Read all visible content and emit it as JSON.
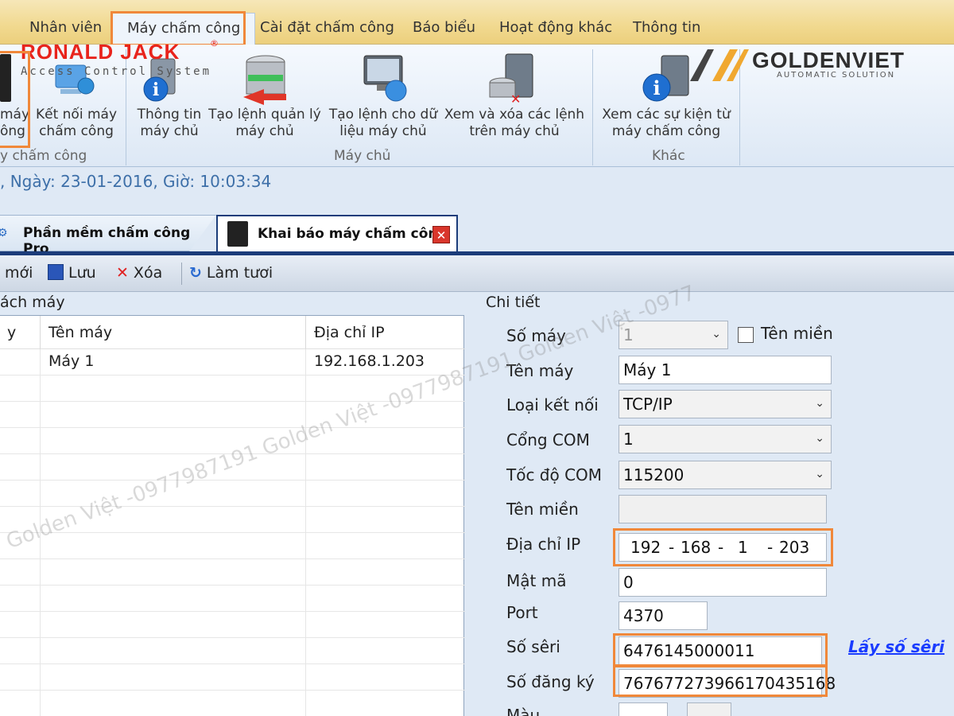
{
  "menu": {
    "items": [
      "Nhân viên",
      "Máy chấm công",
      "Cài đặt chấm công",
      "Báo biểu",
      "Hoạt động khác",
      "Thông tin"
    ],
    "active_index": 1
  },
  "ribbon": {
    "brand_left": {
      "name": "RONALD JACK",
      "reg": "®",
      "tagline": "Access Control System"
    },
    "brand_right": {
      "name": "GOLDENVIET",
      "tagline": "AUTOMATIC SOLUTION"
    },
    "group1": {
      "label": "y chấm công",
      "btn_partial_line1": "máy",
      "btn_partial_line2": "ông",
      "btn_connect_line1": "Kết nối máy",
      "btn_connect_line2": "chấm công"
    },
    "group2": {
      "label": "Máy chủ",
      "buttons": [
        {
          "line1": "Thông tin",
          "line2": "máy chủ"
        },
        {
          "line1": "Tạo lệnh quản lý",
          "line2": "máy chủ"
        },
        {
          "line1": "Tạo lệnh cho dữ",
          "line2": "liệu máy chủ"
        },
        {
          "line1": "Xem và xóa các lệnh",
          "line2": "trên máy chủ"
        }
      ]
    },
    "group3": {
      "label": "Khác",
      "buttons": [
        {
          "line1": "Xem các sự kiện từ",
          "line2": "máy chấm công"
        }
      ]
    }
  },
  "status": {
    "text": ", Ngày: 23-01-2016, Giờ: 10:03:34"
  },
  "tabs": [
    {
      "label": "Phần mềm chấm công Pro",
      "active": false
    },
    {
      "label": "Khai báo máy chấm công",
      "active": true
    }
  ],
  "toolbar": {
    "new": "mới",
    "save": "Lưu",
    "delete": "Xóa",
    "refresh": "Làm tươi"
  },
  "left_panel": {
    "title": "ách máy",
    "columns": [
      "y",
      "Tên máy",
      "Địa chỉ IP"
    ],
    "rows": [
      [
        "",
        "Máy 1",
        "192.168.1.203"
      ]
    ]
  },
  "detail": {
    "title": "Chi tiết",
    "fields": {
      "so_may": {
        "label": "Số máy",
        "value": "1"
      },
      "ten_mien_check": {
        "label": "Tên miền"
      },
      "ten_may": {
        "label": "Tên máy",
        "value": "Máy 1"
      },
      "loai_ket_noi": {
        "label": "Loại kết nối",
        "value": "TCP/IP"
      },
      "cong_com": {
        "label": "Cổng COM",
        "value": "1"
      },
      "toc_do_com": {
        "label": "Tốc độ COM",
        "value": "115200"
      },
      "ten_mien": {
        "label": "Tên miền",
        "value": ""
      },
      "dia_chi_ip": {
        "label": "Địa chỉ IP",
        "octets": [
          "192",
          "168",
          "1",
          "203"
        ],
        "sep": "-"
      },
      "mat_ma": {
        "label": "Mật mã",
        "value": "0"
      },
      "port": {
        "label": "Port",
        "value": "4370"
      },
      "so_seri": {
        "label": "Số sêri",
        "value": "6476145000011"
      },
      "so_dang_ky": {
        "label": "Số đăng ký",
        "value": "767677273966170435168"
      },
      "mau": {
        "label": "Màu"
      }
    },
    "link_get_serial": "Lấy số sêri"
  },
  "watermark": "Golden Việt -0977987191 Golden Việt -0977987191 Golden Việt -0977",
  "colors": {
    "highlight": "#f0883a",
    "tab_border": "#1b3c7a",
    "link": "#1a3cff"
  }
}
